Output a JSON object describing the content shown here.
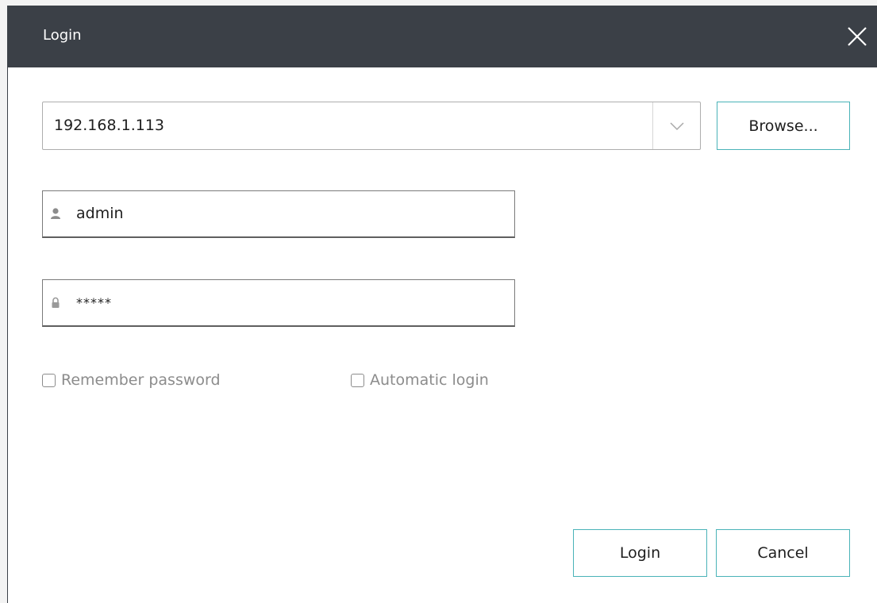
{
  "window": {
    "title": "Login",
    "close_icon": "close-icon"
  },
  "server": {
    "value": "192.168.1.113",
    "dropdown_icon": "chevron-down-icon",
    "browse_label": "Browse..."
  },
  "username": {
    "icon": "user-icon",
    "value": "admin"
  },
  "password": {
    "icon": "lock-icon",
    "value": "*****"
  },
  "options": {
    "remember_label": "Remember password",
    "remember_checked": false,
    "auto_login_label": "Automatic login",
    "auto_login_checked": false
  },
  "actions": {
    "login_label": "Login",
    "cancel_label": "Cancel"
  },
  "colors": {
    "titlebar": "#3b4047",
    "accent_border": "#4ab3b8",
    "muted_text": "#8c8c8c"
  }
}
